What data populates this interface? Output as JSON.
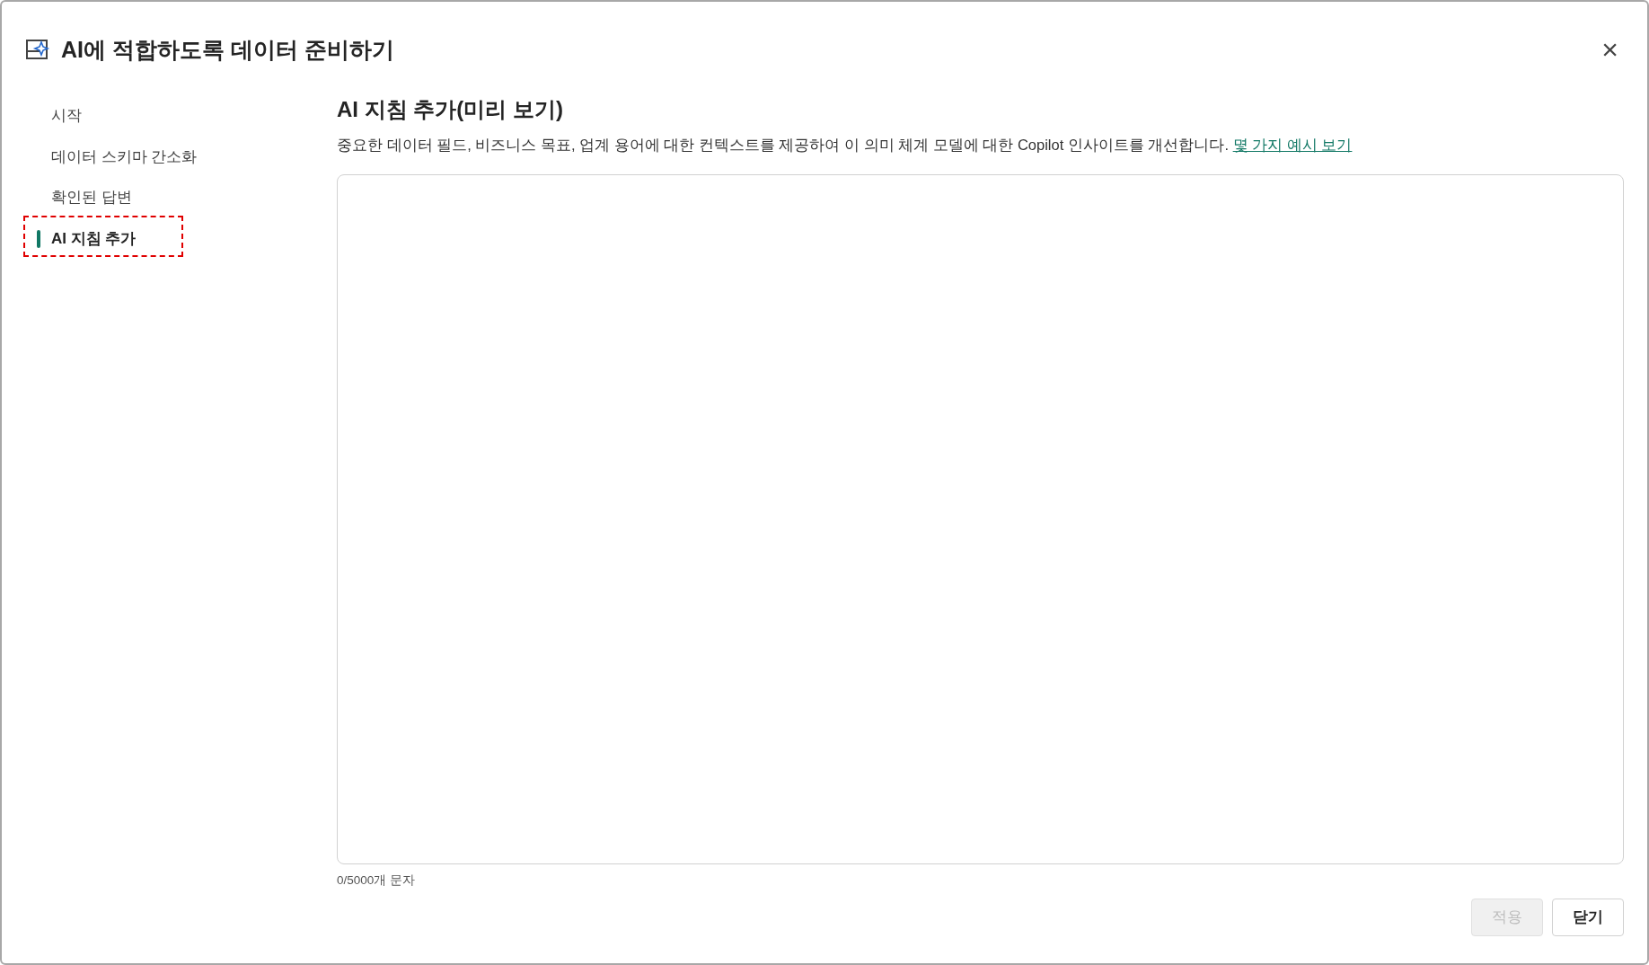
{
  "dialog": {
    "title": "AI에 적합하도록 데이터 준비하기",
    "close": "×"
  },
  "sidebar": {
    "items": [
      {
        "label": "시작",
        "selected": false,
        "annotated": false
      },
      {
        "label": "데이터 스키마 간소화",
        "selected": false,
        "annotated": false
      },
      {
        "label": "확인된 답변",
        "selected": false,
        "annotated": false
      },
      {
        "label": "AI 지침 추가",
        "selected": true,
        "annotated": true
      }
    ]
  },
  "main": {
    "heading": "AI 지침 추가(미리 보기)",
    "description": "중요한 데이터 필드, 비즈니스 목표, 업계 용어에 대한 컨텍스트를 제공하여 이 의미 체계 모델에 대한 Copilot 인사이트를 개선합니다.",
    "link": "몇 가지 예시 보기",
    "character_count": "0/5000개 문자"
  },
  "buttons": [
    {
      "label": "적용",
      "disabled": true
    },
    {
      "label": "닫기",
      "disabled": false
    }
  ]
}
